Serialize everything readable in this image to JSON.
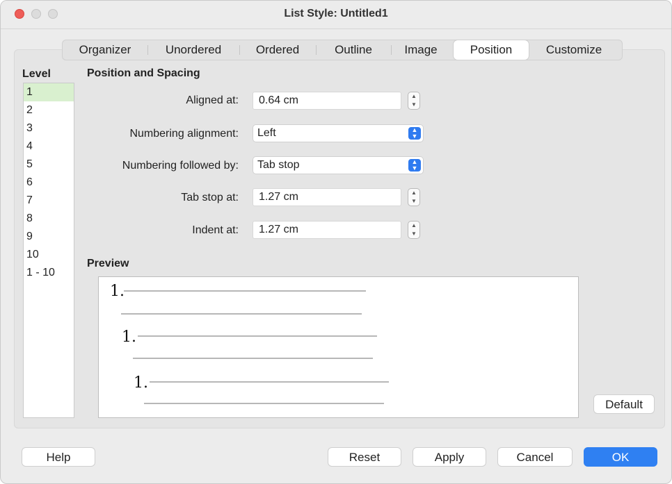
{
  "window": {
    "title": "List Style: Untitled1"
  },
  "tabs": [
    "Organizer",
    "Unordered",
    "Ordered",
    "Outline",
    "Image",
    "Position",
    "Customize"
  ],
  "active_tab": "Position",
  "level": {
    "title": "Level",
    "items": [
      "1",
      "2",
      "3",
      "4",
      "5",
      "6",
      "7",
      "8",
      "9",
      "10",
      "1 - 10"
    ],
    "selected": "1"
  },
  "position": {
    "section_title": "Position and Spacing",
    "aligned_at": {
      "label": "Aligned at:",
      "value": "0.64 cm"
    },
    "numbering_alignment": {
      "label": "Numbering alignment:",
      "value": "Left"
    },
    "numbering_followed_by": {
      "label": "Numbering followed by:",
      "value": "Tab stop"
    },
    "tab_stop_at": {
      "label": "Tab stop at:",
      "value": "1.27 cm"
    },
    "indent_at": {
      "label": "Indent at:",
      "value": "1.27 cm"
    }
  },
  "preview": {
    "title": "Preview",
    "numbers": [
      "1.",
      "1.",
      "1."
    ]
  },
  "buttons": {
    "default": "Default",
    "help": "Help",
    "reset": "Reset",
    "apply": "Apply",
    "cancel": "Cancel",
    "ok": "OK"
  },
  "colors": {
    "accent": "#2f80f2",
    "close": "#ee5d58",
    "selection": "#d9f0cf"
  }
}
